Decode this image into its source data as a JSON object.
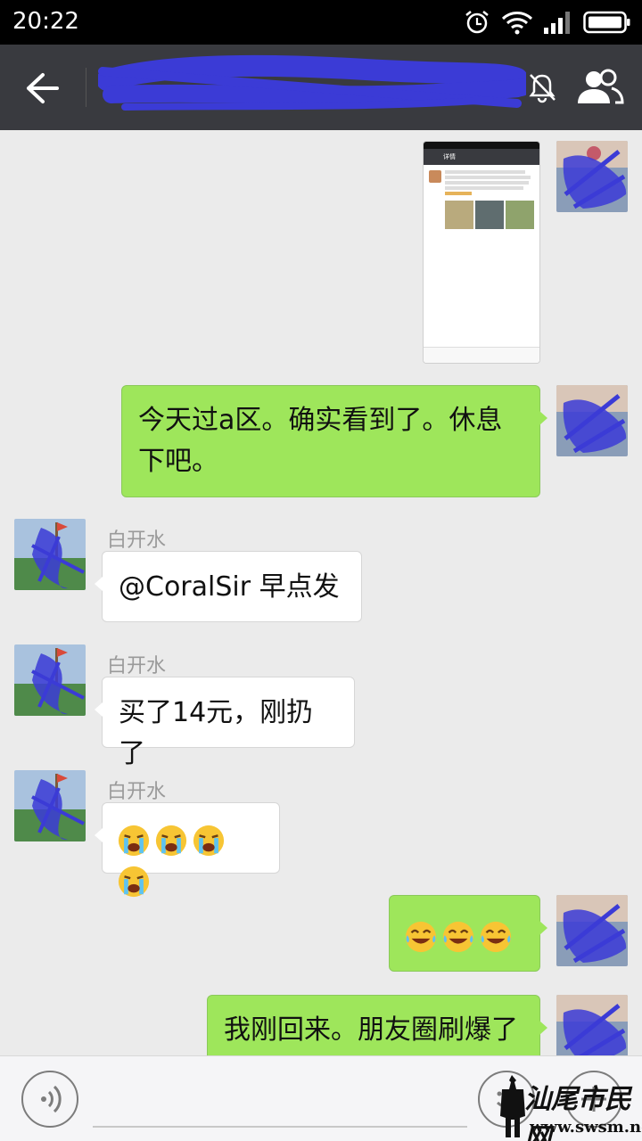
{
  "status_bar": {
    "time": "20:22",
    "icons": [
      "alarm-icon",
      "wifi-icon",
      "signal-icon",
      "battery-icon"
    ]
  },
  "header": {
    "title": "",
    "back_icon": "arrow-left-icon",
    "mute_icon": "mute-bell-icon",
    "group_icon": "group-members-icon",
    "colors": {
      "bar": "#393a3f",
      "scribble": "#3b3bd6"
    }
  },
  "messages": [
    {
      "direction": "outgoing",
      "type": "image"
    },
    {
      "direction": "outgoing",
      "type": "text",
      "text": "今天过a区。确实看到了。休息下吧。"
    },
    {
      "direction": "incoming",
      "type": "text",
      "sender": "白开水",
      "text": "@CoralSir 早点发"
    },
    {
      "direction": "incoming",
      "type": "text",
      "sender": "白开水",
      "text": "买了14元，刚扔了"
    },
    {
      "direction": "incoming",
      "type": "emoji",
      "sender": "白开水",
      "emojis": [
        "loudly-crying-face",
        "loudly-crying-face",
        "loudly-crying-face",
        "loudly-crying-face"
      ]
    },
    {
      "direction": "outgoing",
      "type": "emoji",
      "emojis": [
        "tears-of-joy-face",
        "tears-of-joy-face",
        "tears-of-joy-face"
      ]
    },
    {
      "direction": "outgoing",
      "type": "text",
      "text": "我刚回来。朋友圈刷爆了"
    }
  ],
  "image_preview": {
    "header_text": "详情"
  },
  "input_bar": {
    "voice_icon": "voice-icon",
    "emoji_icon": "emoji-icon",
    "plus_icon": "plus-icon"
  },
  "watermark": {
    "text": "汕尾市民网",
    "url": "www.swsm.net"
  },
  "colors": {
    "chat_bg": "#ebebeb",
    "outgoing_bubble": "#9ee65b",
    "incoming_bubble": "#ffffff"
  }
}
